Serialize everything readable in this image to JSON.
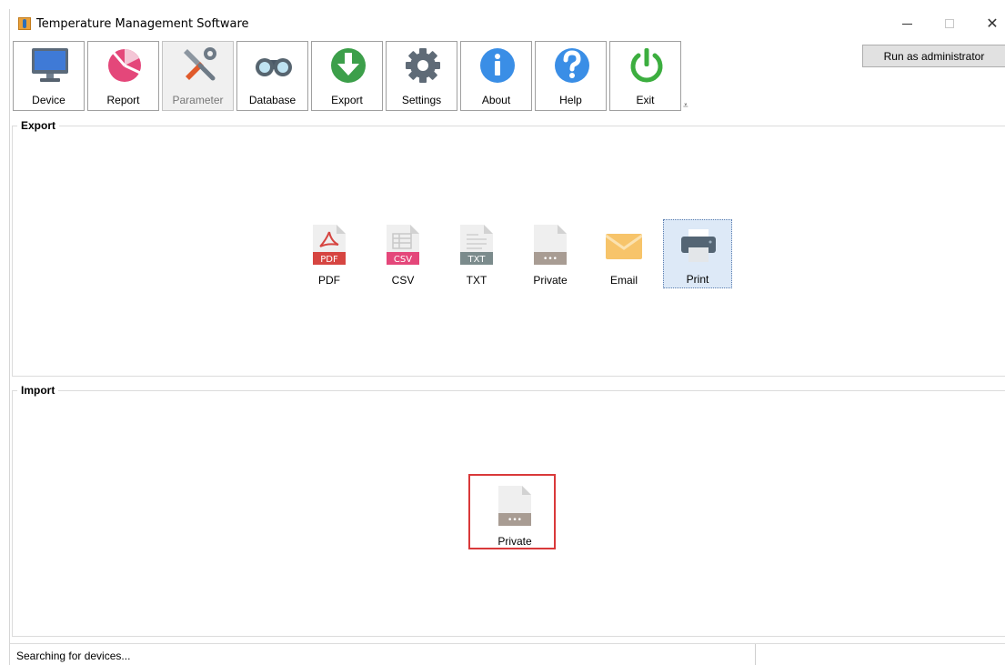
{
  "window": {
    "title": "Temperature Management Software",
    "controls": {
      "minimize": "—",
      "maximize": "□",
      "close": "✕"
    }
  },
  "toolbar": {
    "items": [
      {
        "label": "Device",
        "icon": "monitor-icon"
      },
      {
        "label": "Report",
        "icon": "pie-chart-icon"
      },
      {
        "label": "Parameter",
        "icon": "tools-icon",
        "active": true
      },
      {
        "label": "Database",
        "icon": "binoculars-icon"
      },
      {
        "label": "Export",
        "icon": "export-arrow-icon"
      },
      {
        "label": "Settings",
        "icon": "gear-icon"
      },
      {
        "label": "About",
        "icon": "info-icon"
      },
      {
        "label": "Help",
        "icon": "question-icon"
      },
      {
        "label": "Exit",
        "icon": "power-icon"
      }
    ],
    "overflow": "⩡",
    "admin_button": "Run as administrator"
  },
  "export_group": {
    "title": "Export",
    "items": [
      {
        "label": "PDF",
        "badge": "PDF"
      },
      {
        "label": "CSV",
        "badge": "CSV"
      },
      {
        "label": "TXT",
        "badge": "TXT"
      },
      {
        "label": "Private",
        "badge": "•••"
      },
      {
        "label": "Email"
      },
      {
        "label": "Print",
        "selected": true
      }
    ]
  },
  "import_group": {
    "title": "Import",
    "items": [
      {
        "label": "Private",
        "badge": "•••",
        "highlighted": true
      }
    ]
  },
  "statusbar": {
    "text": "Searching for devices..."
  },
  "colors": {
    "pdf": "#d64541",
    "csv": "#e4477a",
    "txt": "#7b8b8c",
    "private": "#a89c93",
    "highlight": "#d9393a",
    "selection": "#dde9f7"
  }
}
